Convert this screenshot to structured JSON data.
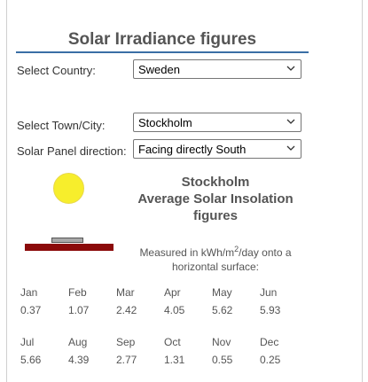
{
  "title": "Solar Irradiance figures",
  "country": {
    "label": "Select Country:",
    "value": "Sweden"
  },
  "town": {
    "label": "Select Town/City:",
    "value": "Stockholm"
  },
  "direction": {
    "label": "Solar Panel direction:",
    "value": "Facing directly South"
  },
  "heading": {
    "city": "Stockholm",
    "line2": "Average Solar Insolation",
    "line3": "figures"
  },
  "measured": {
    "pre": "Measured in kWh/m",
    "sup": "2",
    "post": "/day onto a",
    "line2": "horizontal surface:"
  },
  "months_row1": [
    {
      "month": "Jan",
      "value": "0.37"
    },
    {
      "month": "Feb",
      "value": "1.07"
    },
    {
      "month": "Mar",
      "value": "2.42"
    },
    {
      "month": "Apr",
      "value": "4.05"
    },
    {
      "month": "May",
      "value": "5.62"
    },
    {
      "month": "Jun",
      "value": "5.93"
    }
  ],
  "months_row2": [
    {
      "month": "Jul",
      "value": "5.66"
    },
    {
      "month": "Aug",
      "value": "4.39"
    },
    {
      "month": "Sep",
      "value": "2.77"
    },
    {
      "month": "Oct",
      "value": "1.31"
    },
    {
      "month": "Nov",
      "value": "0.55"
    },
    {
      "month": "Dec",
      "value": "0.25"
    }
  ],
  "colors": {
    "title_rule": "#3a6ea5",
    "sun": "#f7ee2c",
    "ground": "#8b0a0a"
  },
  "icons": {
    "dropdown": "chevron-down-icon",
    "sun": "sun-icon",
    "panel": "solar-panel-icon"
  }
}
